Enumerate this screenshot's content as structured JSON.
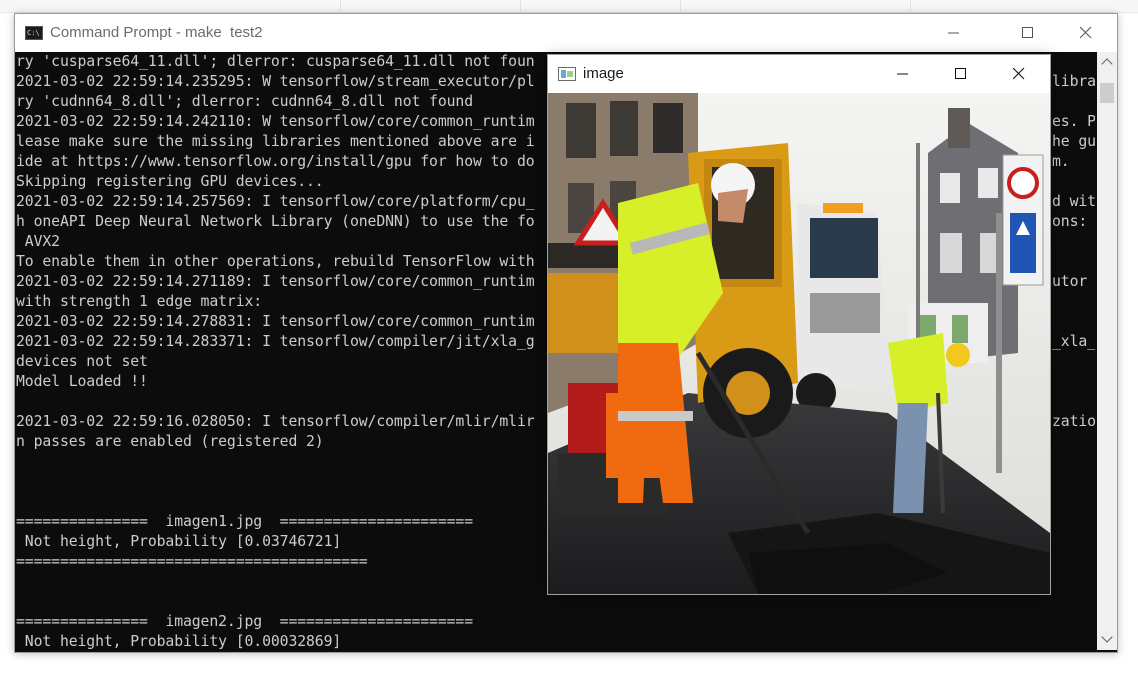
{
  "cmd_window": {
    "title": "Command Prompt - make  test2",
    "lines": [
      "ry 'cusparse64_11.dll'; dlerror: cusparse64_11.dll not foun",
      "2021-03-02 22:59:14.235295: W tensorflow/stream_executor/pl",
      "ry 'cudnn64_8.dll'; dlerror: cudnn64_8.dll not found",
      "2021-03-02 22:59:14.242110: W tensorflow/core/common_runtim",
      "lease make sure the missing libraries mentioned above are i",
      "ide at https://www.tensorflow.org/install/gpu for how to do",
      "Skipping registering GPU devices...",
      "2021-03-02 22:59:14.257569: I tensorflow/core/platform/cpu_",
      "h oneAPI Deep Neural Network Library (oneDNN) to use the fo",
      " AVX2",
      "To enable them in other operations, rebuild TensorFlow with",
      "2021-03-02 22:59:14.271189: I tensorflow/core/common_runtim",
      "with strength 1 edge matrix:",
      "2021-03-02 22:59:14.278831: I tensorflow/core/common_runtim",
      "2021-03-02 22:59:14.283371: I tensorflow/compiler/jit/xla_g",
      "devices not set",
      "Model Loaded !!",
      "",
      "2021-03-02 22:59:16.028050: I tensorflow/compiler/mlir/mlir",
      "n passes are enabled (registered 2)",
      "",
      "",
      "",
      "===============  imagen1.jpg  ======================",
      " Not height, Probability [0.03746721]",
      "========================================",
      "",
      "",
      "===============  imagen2.jpg  ======================",
      " Not height, Probability [0.00032869]"
    ],
    "right_fragments": [
      {
        "line": 1,
        "text": "libra"
      },
      {
        "line": 3,
        "text": "es. P"
      },
      {
        "line": 4,
        "text": "he gu"
      },
      {
        "line": 5,
        "text": "m."
      },
      {
        "line": 7,
        "text": "d wit"
      },
      {
        "line": 8,
        "text": "ons:"
      },
      {
        "line": 11,
        "text": "utor"
      },
      {
        "line": 14,
        "text": "_xla_"
      },
      {
        "line": 18,
        "text": "zatio"
      }
    ]
  },
  "image_window": {
    "title": "image"
  }
}
